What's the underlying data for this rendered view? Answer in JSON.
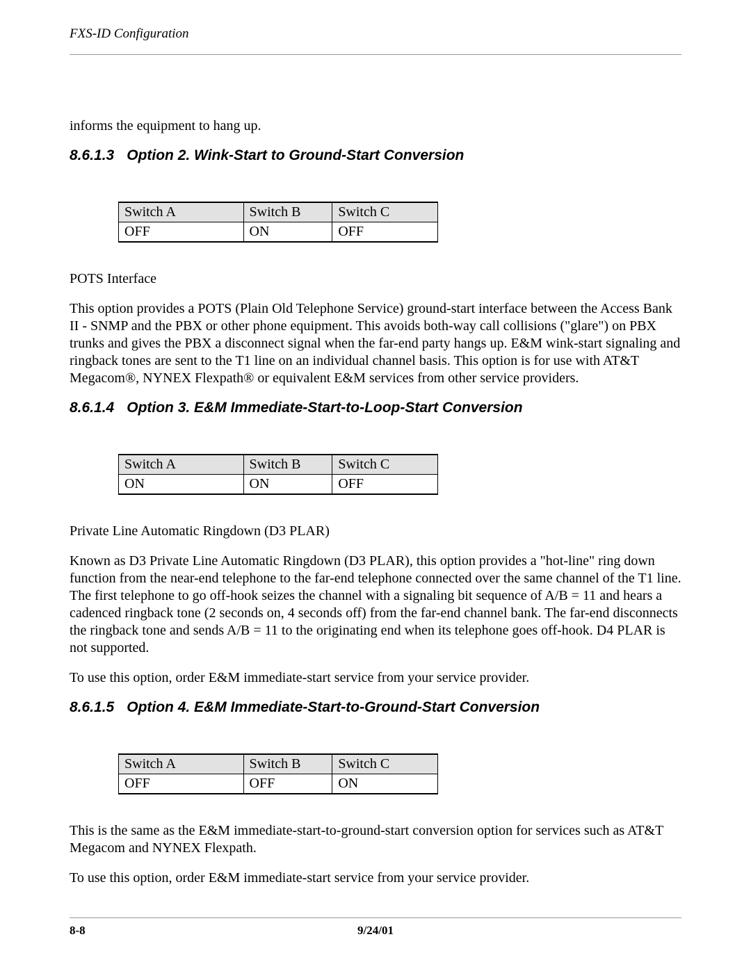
{
  "header": {
    "title": "FXS-ID Configuration"
  },
  "intro_continued": "informs the equipment to hang up.",
  "sec813": {
    "number": "8.6.1.3",
    "title": "Option 2. Wink-Start to Ground-Start Conversion",
    "table": {
      "headers": [
        "Switch A",
        "Switch B",
        "Switch C"
      ],
      "row": [
        "OFF",
        "ON",
        "OFF"
      ]
    },
    "p1": "POTS Interface",
    "p2": "This option provides a POTS (Plain Old Telephone Service) ground-start interface between the Access Bank II - SNMP and the PBX or other phone equipment. This avoids both-way call collisions (\"glare\") on PBX trunks and gives the PBX a disconnect signal when the far-end party hangs up. E&M wink-start signaling and ringback tones are sent to the T1 line on an individual channel basis. This option is for use with AT&T Megacom®, NYNEX Flexpath® or equivalent E&M services from other service providers."
  },
  "sec814": {
    "number": "8.6.1.4",
    "title": "Option 3. E&M Immediate-Start-to-Loop-Start Conversion",
    "table": {
      "headers": [
        "Switch A",
        "Switch B",
        "Switch C"
      ],
      "row": [
        "ON",
        "ON",
        "OFF"
      ]
    },
    "p1": "Private Line Automatic Ringdown (D3 PLAR)",
    "p2": "Known as D3 Private Line Automatic Ringdown (D3 PLAR), this option provides a \"hot-line\" ring down function from the near-end telephone to the far-end telephone connected over the same channel of the T1 line. The first telephone to go off-hook seizes the channel with a signaling bit sequence of A/B = 11 and hears a cadenced ringback tone (2 seconds on, 4 seconds off) from the far-end channel bank. The far-end disconnects the ringback tone and sends A/B = 11 to the originating end when its telephone goes off-hook. D4 PLAR is not supported.",
    "p3": "To use this option, order E&M immediate-start service from your service provider."
  },
  "sec815": {
    "number": "8.6.1.5",
    "title": "Option 4. E&M Immediate-Start-to-Ground-Start Conversion",
    "table": {
      "headers": [
        "Switch A",
        "Switch B",
        "Switch C"
      ],
      "row": [
        "OFF",
        "OFF",
        "ON"
      ]
    },
    "p1": "This is the same as the E&M immediate-start-to-ground-start conversion option for services such as AT&T Megacom and NYNEX Flexpath.",
    "p2": "To use this option, order E&M immediate-start service from your service provider."
  },
  "footer": {
    "page": "8-8",
    "date": "9/24/01"
  }
}
